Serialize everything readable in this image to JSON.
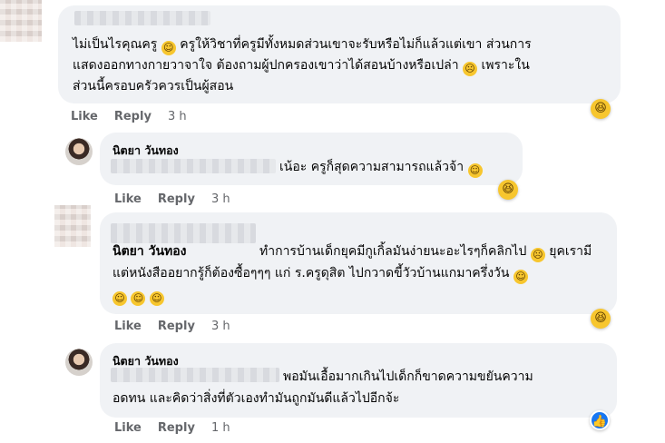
{
  "comments": [
    {
      "author": "",
      "text": "ไม่เป็นไรคุณครู 😀 ครูให้วิชาที่ครูมีทั้งหมดส่วนเขาจะรับหรือไม่ก็แล้วแต่เขา ส่วนการแสดงออกทางกายวาจาใจ ต้องถามผู้ปกครองเขาว่าได้สอนบ้างหรือเปล่า 😭 เพราะในส่วนนี้ครอบครัวควรเป็นผู้สอน",
      "line1": "ไม่เป็นไรคุณครู",
      "line1b": "ครูให้วิชาที่ครูมีทั้งหมดส่วนเขาจะรับหรือไม่ก็แล้วแต่เขา ส่วนการ",
      "line2": "แสดงออกทางกายวาจาใจ ต้องถามผู้ปกครองเขาว่าได้สอนบ้างหรือเปล่า",
      "line2b": "เพราะใน",
      "line3": "ส่วนนี้ครอบครัวควรเป็นผู้สอน",
      "like": "Like",
      "reply": "Reply",
      "time": "3 h",
      "reaction_icon": "laughing-emoji-icon"
    },
    {
      "author": "นิตยา วันทอง",
      "text": "เน้อะ ครูก็สุดความสามารถแล้วจ้า",
      "like": "Like",
      "reply": "Reply",
      "time": "3 h",
      "reaction_icon": "laughing-emoji-icon"
    },
    {
      "author": "นิตยา วันทอง",
      "line1": "ทำการบ้านเด็กยุคมีกูเกิ้ลมันง่ายนะอะไรๆก็คลิกไป",
      "line1b": "ยุคเรามี",
      "line2": "แต่หนังสืออยากรู้ก็ต้องซื้อๆๆๆ แก่ ร.ครูดุสิต ไปกวาดขี้วัวบ้านแกมาครึ่งวัน",
      "like": "Like",
      "reply": "Reply",
      "time": "3 h",
      "reaction_icon": "laughing-emoji-icon"
    },
    {
      "author": "นิตยา วันทอง",
      "line1": "พอมันเอื้อมากเกินไปเด็กก็ขาดความขยันความ",
      "line2": "อดทน และคิดว่าสิ่งที่ตัวเองทำมันถูกมันดีแล้วไปอีกจ้ะ",
      "like": "Like",
      "reply": "Reply",
      "time": "1 h",
      "reaction_icon": "like-reaction-icon"
    }
  ],
  "colors": {
    "bubble": "#f0f2f5",
    "meta": "#65676b",
    "like_blue": "#1877f2",
    "emoji_yellow": "#f7c62e"
  }
}
